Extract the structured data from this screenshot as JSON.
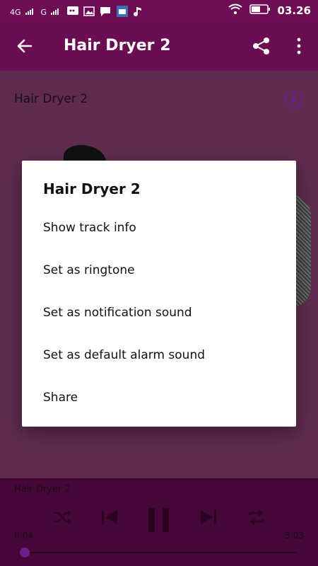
{
  "statusbar": {
    "network_left": "4G",
    "network_right": "G",
    "time": "03.26"
  },
  "appbar": {
    "title": "Hair Dryer 2"
  },
  "content": {
    "track_title": "Hair Dryer 2"
  },
  "dialog": {
    "title": "Hair Dryer 2",
    "items": [
      "Show track info",
      "Set as ringtone",
      "Set as notification sound",
      "Set as default alarm sound",
      "Share"
    ]
  },
  "player": {
    "title": "Hair Dryer 2",
    "elapsed": "0:04",
    "duration": "5:03",
    "progress_fraction": 0.013
  },
  "colors": {
    "primary": "#6a0d52",
    "accent": "#6b1f8a"
  }
}
